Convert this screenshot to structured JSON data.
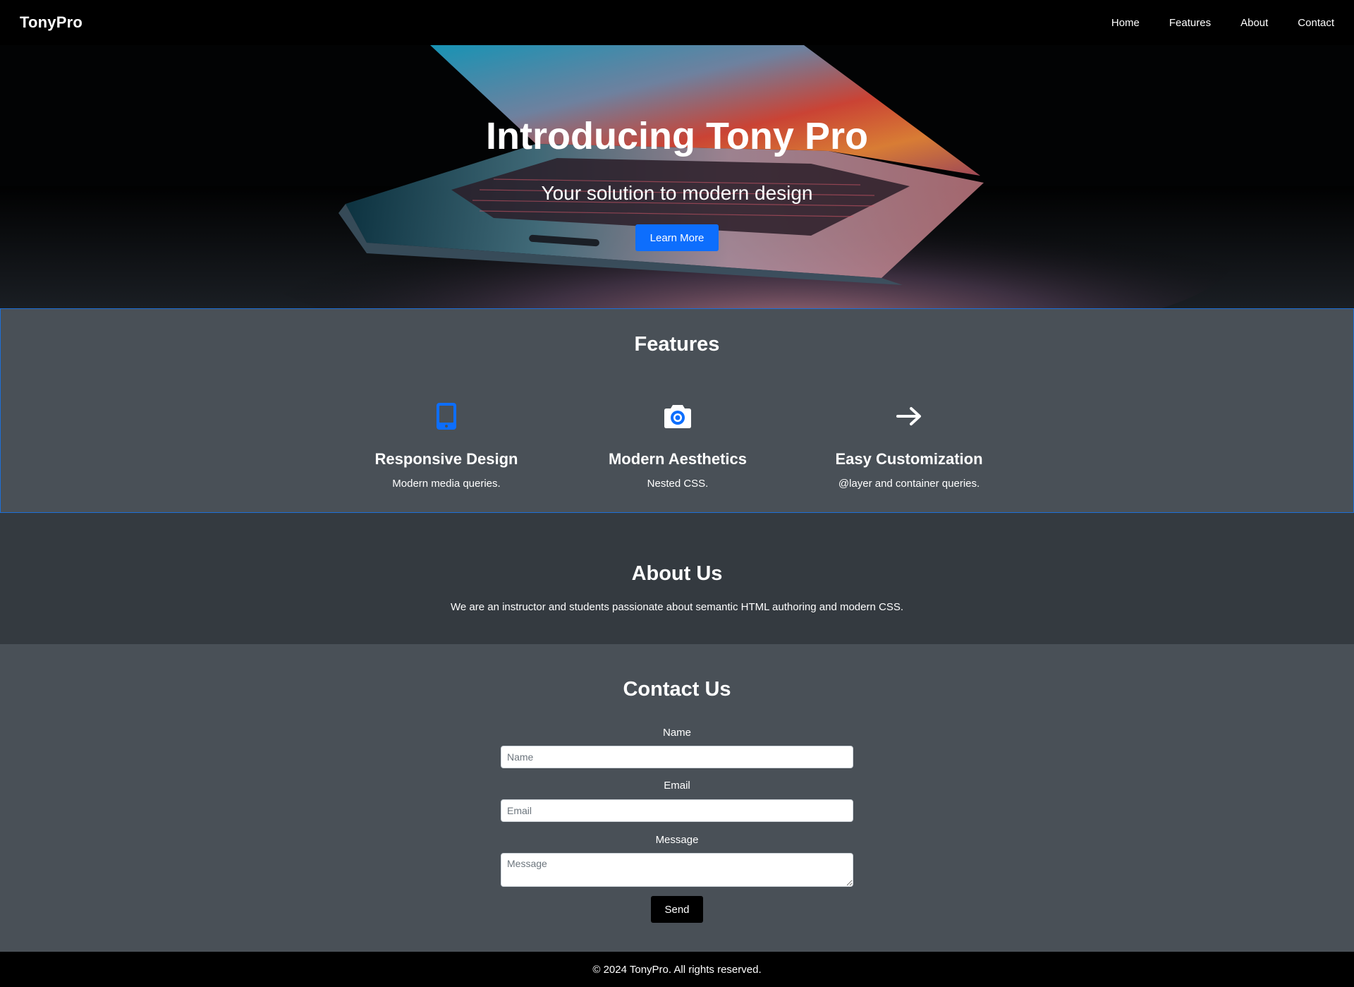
{
  "header": {
    "logo": "TonyPro",
    "nav": [
      {
        "label": "Home"
      },
      {
        "label": "Features"
      },
      {
        "label": "About"
      },
      {
        "label": "Contact"
      }
    ]
  },
  "hero": {
    "title": "Introducing Tony Pro",
    "subtitle": "Your solution to modern design",
    "button_label": "Learn More"
  },
  "features": {
    "title": "Features",
    "items": [
      {
        "icon": "tablet-icon",
        "title": "Responsive Design",
        "description": "Modern media queries."
      },
      {
        "icon": "camera-icon",
        "title": "Modern Aesthetics",
        "description": "Nested CSS."
      },
      {
        "icon": "arrow-right-icon",
        "title": "Easy Customization",
        "description": "@layer and container queries."
      }
    ]
  },
  "about": {
    "title": "About Us",
    "text": "We are an instructor and students passionate about semantic HTML authoring and modern CSS."
  },
  "contact": {
    "title": "Contact Us",
    "name_label": "Name",
    "name_placeholder": "Name",
    "email_label": "Email",
    "email_placeholder": "Email",
    "message_label": "Message",
    "message_placeholder": "Message",
    "send_label": "Send"
  },
  "footer": {
    "text": "© 2024 TonyPro. All rights reserved."
  },
  "colors": {
    "accent": "#0d6efd",
    "features_bg": "#495057",
    "about_bg": "#343a40",
    "contact_bg": "#495057",
    "header_bg": "#000000"
  }
}
